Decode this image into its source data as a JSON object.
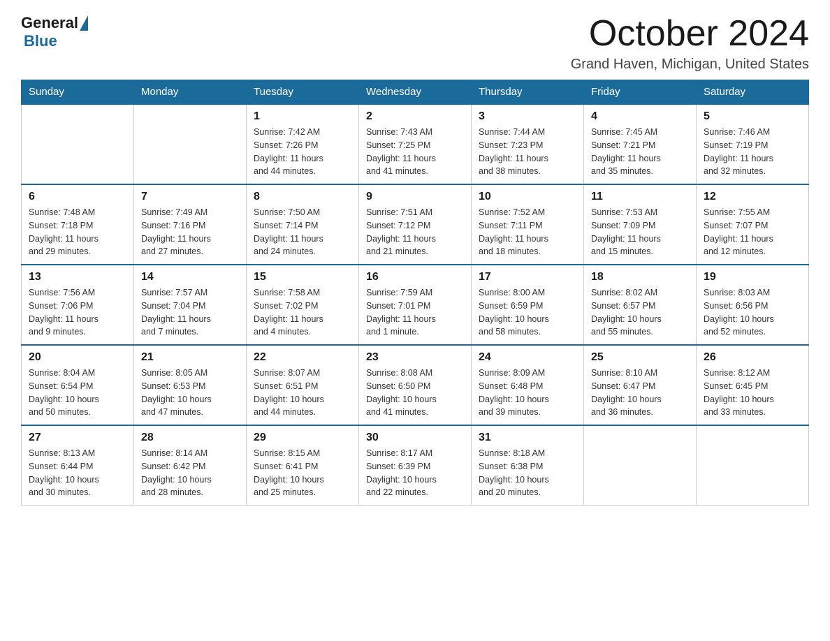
{
  "logo": {
    "general": "General",
    "blue": "Blue"
  },
  "title": "October 2024",
  "location": "Grand Haven, Michigan, United States",
  "days_of_week": [
    "Sunday",
    "Monday",
    "Tuesday",
    "Wednesday",
    "Thursday",
    "Friday",
    "Saturday"
  ],
  "weeks": [
    [
      {
        "day": "",
        "info": ""
      },
      {
        "day": "",
        "info": ""
      },
      {
        "day": "1",
        "info": "Sunrise: 7:42 AM\nSunset: 7:26 PM\nDaylight: 11 hours\nand 44 minutes."
      },
      {
        "day": "2",
        "info": "Sunrise: 7:43 AM\nSunset: 7:25 PM\nDaylight: 11 hours\nand 41 minutes."
      },
      {
        "day": "3",
        "info": "Sunrise: 7:44 AM\nSunset: 7:23 PM\nDaylight: 11 hours\nand 38 minutes."
      },
      {
        "day": "4",
        "info": "Sunrise: 7:45 AM\nSunset: 7:21 PM\nDaylight: 11 hours\nand 35 minutes."
      },
      {
        "day": "5",
        "info": "Sunrise: 7:46 AM\nSunset: 7:19 PM\nDaylight: 11 hours\nand 32 minutes."
      }
    ],
    [
      {
        "day": "6",
        "info": "Sunrise: 7:48 AM\nSunset: 7:18 PM\nDaylight: 11 hours\nand 29 minutes."
      },
      {
        "day": "7",
        "info": "Sunrise: 7:49 AM\nSunset: 7:16 PM\nDaylight: 11 hours\nand 27 minutes."
      },
      {
        "day": "8",
        "info": "Sunrise: 7:50 AM\nSunset: 7:14 PM\nDaylight: 11 hours\nand 24 minutes."
      },
      {
        "day": "9",
        "info": "Sunrise: 7:51 AM\nSunset: 7:12 PM\nDaylight: 11 hours\nand 21 minutes."
      },
      {
        "day": "10",
        "info": "Sunrise: 7:52 AM\nSunset: 7:11 PM\nDaylight: 11 hours\nand 18 minutes."
      },
      {
        "day": "11",
        "info": "Sunrise: 7:53 AM\nSunset: 7:09 PM\nDaylight: 11 hours\nand 15 minutes."
      },
      {
        "day": "12",
        "info": "Sunrise: 7:55 AM\nSunset: 7:07 PM\nDaylight: 11 hours\nand 12 minutes."
      }
    ],
    [
      {
        "day": "13",
        "info": "Sunrise: 7:56 AM\nSunset: 7:06 PM\nDaylight: 11 hours\nand 9 minutes."
      },
      {
        "day": "14",
        "info": "Sunrise: 7:57 AM\nSunset: 7:04 PM\nDaylight: 11 hours\nand 7 minutes."
      },
      {
        "day": "15",
        "info": "Sunrise: 7:58 AM\nSunset: 7:02 PM\nDaylight: 11 hours\nand 4 minutes."
      },
      {
        "day": "16",
        "info": "Sunrise: 7:59 AM\nSunset: 7:01 PM\nDaylight: 11 hours\nand 1 minute."
      },
      {
        "day": "17",
        "info": "Sunrise: 8:00 AM\nSunset: 6:59 PM\nDaylight: 10 hours\nand 58 minutes."
      },
      {
        "day": "18",
        "info": "Sunrise: 8:02 AM\nSunset: 6:57 PM\nDaylight: 10 hours\nand 55 minutes."
      },
      {
        "day": "19",
        "info": "Sunrise: 8:03 AM\nSunset: 6:56 PM\nDaylight: 10 hours\nand 52 minutes."
      }
    ],
    [
      {
        "day": "20",
        "info": "Sunrise: 8:04 AM\nSunset: 6:54 PM\nDaylight: 10 hours\nand 50 minutes."
      },
      {
        "day": "21",
        "info": "Sunrise: 8:05 AM\nSunset: 6:53 PM\nDaylight: 10 hours\nand 47 minutes."
      },
      {
        "day": "22",
        "info": "Sunrise: 8:07 AM\nSunset: 6:51 PM\nDaylight: 10 hours\nand 44 minutes."
      },
      {
        "day": "23",
        "info": "Sunrise: 8:08 AM\nSunset: 6:50 PM\nDaylight: 10 hours\nand 41 minutes."
      },
      {
        "day": "24",
        "info": "Sunrise: 8:09 AM\nSunset: 6:48 PM\nDaylight: 10 hours\nand 39 minutes."
      },
      {
        "day": "25",
        "info": "Sunrise: 8:10 AM\nSunset: 6:47 PM\nDaylight: 10 hours\nand 36 minutes."
      },
      {
        "day": "26",
        "info": "Sunrise: 8:12 AM\nSunset: 6:45 PM\nDaylight: 10 hours\nand 33 minutes."
      }
    ],
    [
      {
        "day": "27",
        "info": "Sunrise: 8:13 AM\nSunset: 6:44 PM\nDaylight: 10 hours\nand 30 minutes."
      },
      {
        "day": "28",
        "info": "Sunrise: 8:14 AM\nSunset: 6:42 PM\nDaylight: 10 hours\nand 28 minutes."
      },
      {
        "day": "29",
        "info": "Sunrise: 8:15 AM\nSunset: 6:41 PM\nDaylight: 10 hours\nand 25 minutes."
      },
      {
        "day": "30",
        "info": "Sunrise: 8:17 AM\nSunset: 6:39 PM\nDaylight: 10 hours\nand 22 minutes."
      },
      {
        "day": "31",
        "info": "Sunrise: 8:18 AM\nSunset: 6:38 PM\nDaylight: 10 hours\nand 20 minutes."
      },
      {
        "day": "",
        "info": ""
      },
      {
        "day": "",
        "info": ""
      }
    ]
  ]
}
